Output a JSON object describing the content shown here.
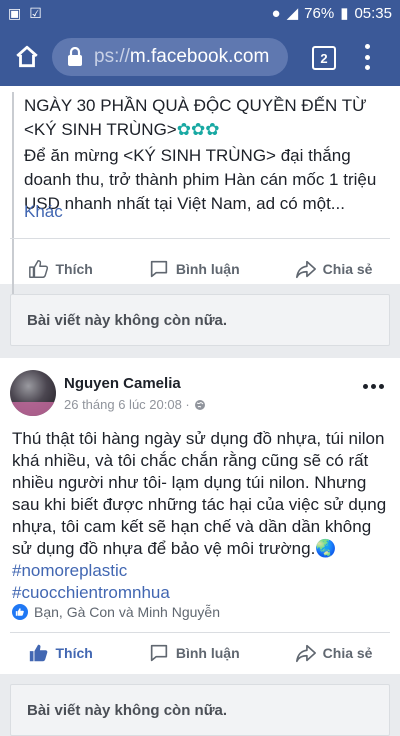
{
  "status_bar": {
    "battery": "76%",
    "time": "05:35"
  },
  "browser": {
    "url_prefix": "ps://",
    "url_host": "m.facebook.com",
    "tab_count": "2"
  },
  "shared_post": {
    "line1": "NGÀY 30 PHẦN QUÀ ĐỘC QUYỀN ĐẾN TỪ <KÝ SINH TRÙNG>",
    "emoji": "✿✿✿",
    "line2": "Để ăn mừng <KÝ SINH TRÙNG> đại thắng doanh thu, trở thành phim Hàn cán mốc 1 triệu USD nhanh nhất tại Việt Nam, ad có một...",
    "more": "Khác"
  },
  "actions1": {
    "like": "Thích",
    "comment": "Bình luận",
    "share": "Chia sẻ"
  },
  "notice1": "Bài viết này không còn nữa.",
  "post2": {
    "author": "Nguyen Camelia",
    "time": "26 tháng 6 lúc 20:08 · ",
    "text": "Thú thật tôi hàng ngày sử dụng đồ nhựa, túi nilon khá nhiều, và tôi chắc chắn rằng cũng sẽ có rất nhiều người như tôi- lạm dụng túi nilon. Nhưng sau khi biết được những tác hại của việc sử dụng nhựa, tôi cam kết sẽ hạn chế và dần dần không sử dụng đồ nhựa để bảo vệ môi trường.🌏",
    "hashtag1": "#nomoreplastic",
    "hashtag2": "#cuocchientromnhua",
    "reactions": "Bạn, Gà Con và Minh Nguyễn"
  },
  "actions2": {
    "like": "Thích",
    "comment": "Bình luận",
    "share": "Chia sẻ"
  },
  "notice2": "Bài viết này không còn nữa.",
  "colors": {
    "brand": "#3b5998",
    "link": "#4267b2",
    "like_active": "#2078f4"
  }
}
